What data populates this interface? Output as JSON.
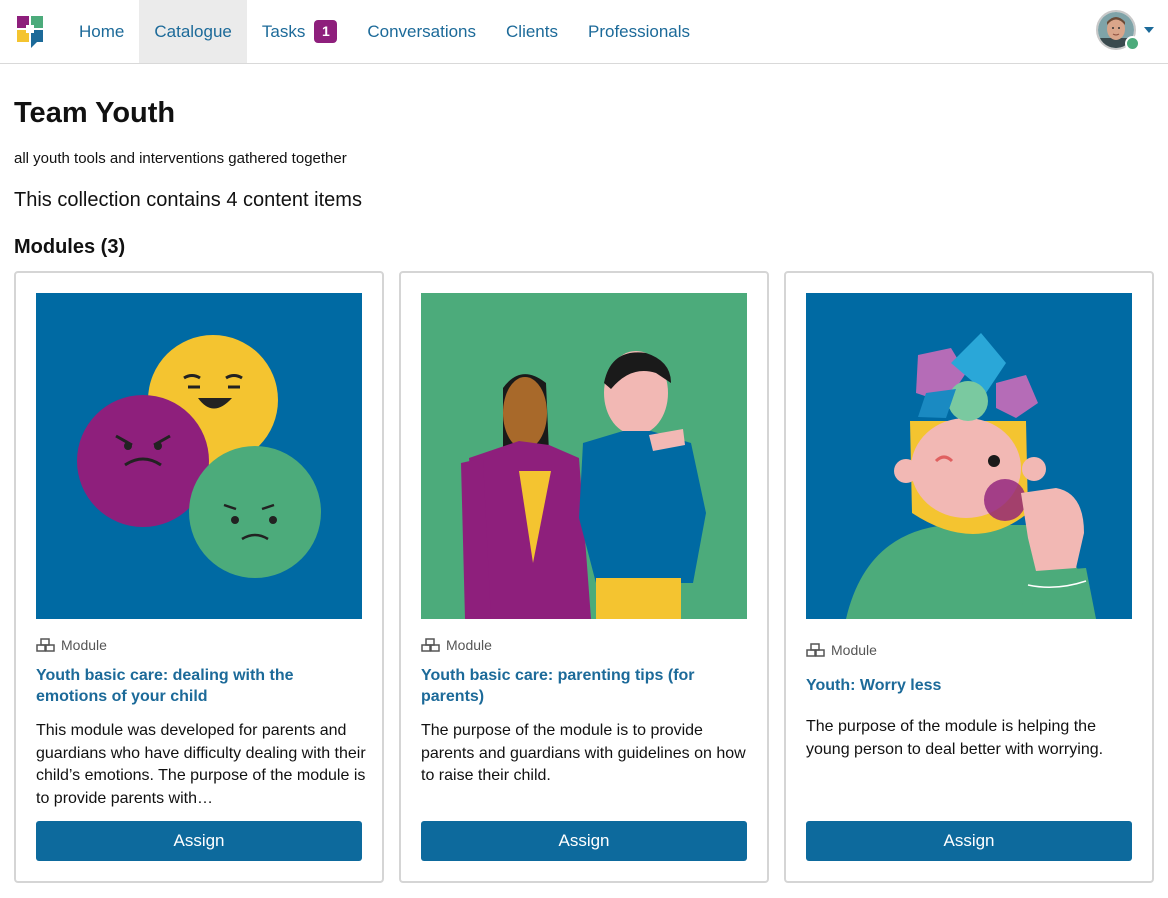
{
  "nav": {
    "items": [
      {
        "label": "Home"
      },
      {
        "label": "Catalogue"
      },
      {
        "label": "Tasks",
        "badge": "1"
      },
      {
        "label": "Conversations"
      },
      {
        "label": "Clients"
      },
      {
        "label": "Professionals"
      }
    ],
    "active": "Catalogue"
  },
  "page": {
    "title": "Team Youth",
    "description": "all youth tools and interventions gathered together",
    "count_text": "This collection contains 4 content items",
    "section_title": "Modules (3)"
  },
  "cards": [
    {
      "type_label": "Module",
      "title": "Youth basic care: dealing with the emotions of your child",
      "description": "This module was developed for parents and guardians who have difficulty dealing with their child’s emotions. The purpose of the module is to provide parents with…",
      "button": "Assign",
      "image_icon": "emotion-faces-illustration"
    },
    {
      "type_label": "Module",
      "title": "Youth basic care: parenting tips (for parents)",
      "description": "The purpose of the module is to provide parents and guardians with guidelines on how to raise their child.",
      "button": "Assign",
      "image_icon": "parent-and-child-illustration"
    },
    {
      "type_label": "Module",
      "title": "Youth: Worry less",
      "description": "The purpose of the module is helping the young person to deal better with worrying.",
      "button": "Assign",
      "image_icon": "worry-head-illustration"
    }
  ],
  "colors": {
    "link": "#1c6a99",
    "button": "#0d6a9d",
    "badge": "#8e1f7c",
    "card_blue": "#006aa3",
    "card_green": "#4cab7b"
  }
}
